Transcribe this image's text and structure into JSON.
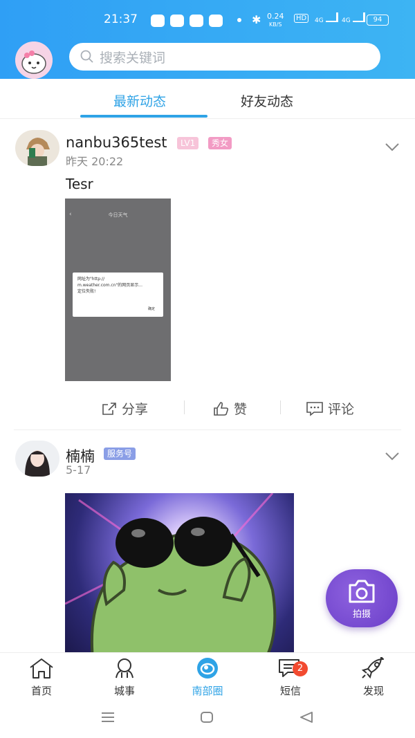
{
  "status_bar": {
    "time": "21:37",
    "net_speed": "0.24",
    "net_unit": "KB/S",
    "hd": "HD",
    "signal1": "4G",
    "signal2": "4G",
    "battery": "94"
  },
  "search": {
    "placeholder": "搜索关键词"
  },
  "tabs": [
    {
      "label": "最新动态",
      "active": true
    },
    {
      "label": "好友动态",
      "active": false
    }
  ],
  "posts": [
    {
      "username": "nanbu365test",
      "level_badge": "LV1",
      "tag_badge": "秀女",
      "time": "昨天 20:22",
      "text": "Tesr",
      "screenshot": {
        "title": "今日天气",
        "dialog_line1": "网址为\"http://",
        "dialog_line2": "m.weather.com.cn\"的网页显示...",
        "dialog_line3": "定位失败!",
        "dialog_button": "确定"
      },
      "actions": {
        "share": "分享",
        "like": "赞",
        "comment": "评论"
      }
    },
    {
      "username": "楠楠",
      "tag_badge": "服务号",
      "time": "5-17"
    }
  ],
  "fab": {
    "label": "拍摄"
  },
  "bottom_nav": [
    {
      "label": "首页",
      "icon": "home-icon"
    },
    {
      "label": "城事",
      "icon": "city-icon"
    },
    {
      "label": "南部圈",
      "icon": "circle-icon",
      "active": true
    },
    {
      "label": "短信",
      "icon": "message-icon",
      "badge": "2"
    },
    {
      "label": "发现",
      "icon": "rocket-icon"
    }
  ],
  "colors": {
    "accent": "#2fa3e6",
    "header": "#35aaf4",
    "fab": "#7a4fd6",
    "badge": "#f24a30"
  }
}
